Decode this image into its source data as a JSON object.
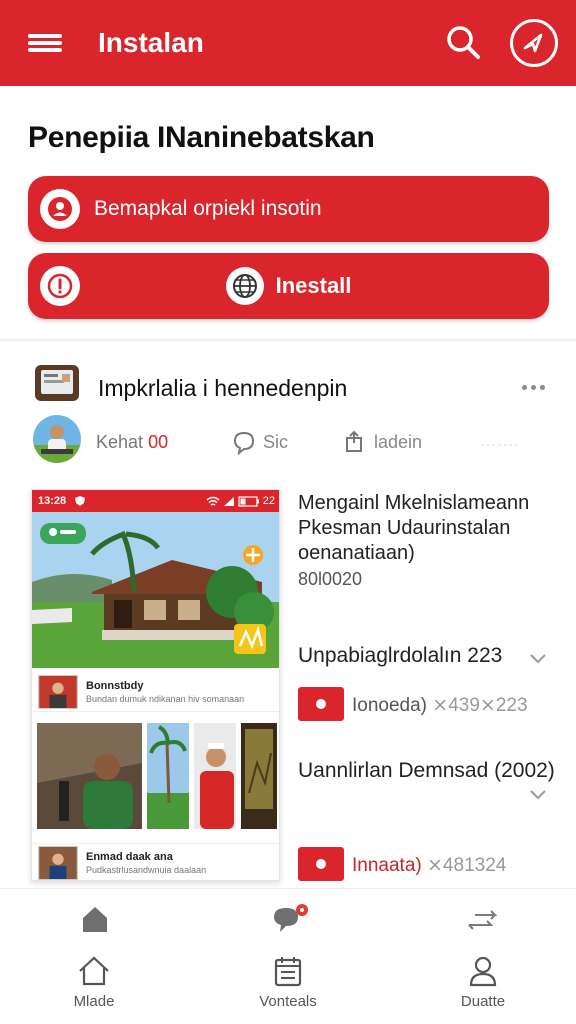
{
  "appbar": {
    "title": "Instalan",
    "brand_color": "#d9252b"
  },
  "main": {
    "heading": "Penepiia INaninebatskan",
    "primary_button": "Bemapkal orpiekl insotin",
    "install_button": "Inestall"
  },
  "post": {
    "title": "Impkrlalia i hennedenpin",
    "likes_label": "Kehat",
    "likes_count": "00",
    "comment_label": "Sic",
    "share_label": "ladein",
    "dots": "·······"
  },
  "preview": {
    "status_time": "13:28",
    "battery": "22",
    "badge": "",
    "card1_title": "Bonnstbdy",
    "card1_sub": "Bundan dumuk ndikanan hiv somanaan",
    "card2_title": "Enmad daak ana",
    "card2_sub": "Pudkastrlusandwnuia daalaan"
  },
  "details": {
    "title": "Mengainl Mkelnislameann Pkesman Udaurinstalan oenanatiaan)",
    "date": "80l0020",
    "section1": "Unpabiaglrdolalın 223",
    "tag1_main": "Ionoeda)",
    "tag1_dim": "⨯439⨯223",
    "section2": "Uannlirlan Demnsad (2002)",
    "tag2_main": "Innaata)",
    "tag2_dim": "⨯481324"
  },
  "bottom_nav": {
    "items": [
      {
        "label": "Mlade",
        "icon": "home-outline-icon"
      },
      {
        "label": "Vonteals",
        "icon": "calendar-icon"
      },
      {
        "label": "Duatte",
        "icon": "person-icon"
      }
    ],
    "notification_color": "#e53935"
  }
}
